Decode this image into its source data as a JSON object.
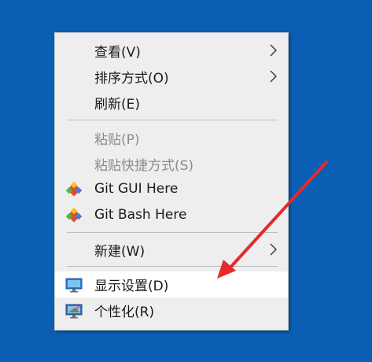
{
  "context_menu": {
    "items": [
      {
        "label": "查看(V)",
        "has_submenu": true
      },
      {
        "label": "排序方式(O)",
        "has_submenu": true
      },
      {
        "label": "刷新(E)",
        "has_submenu": false
      },
      {
        "label": "粘贴(P)",
        "disabled": true
      },
      {
        "label": "粘贴快捷方式(S)",
        "disabled": true
      },
      {
        "label": "Git GUI Here",
        "icon": "git-icon"
      },
      {
        "label": "Git Bash Here",
        "icon": "git-icon"
      },
      {
        "label": "新建(W)",
        "has_submenu": true
      },
      {
        "label": "显示设置(D)",
        "icon": "display-icon",
        "highlighted": true
      },
      {
        "label": "个性化(R)",
        "icon": "personalize-icon"
      }
    ]
  },
  "colors": {
    "desktop_background": "#0a5fb4",
    "menu_background": "#eeeeee",
    "highlight_background": "#ffffff",
    "annotation_arrow": "#e32b2b",
    "disabled_text": "#8c8c8c"
  }
}
